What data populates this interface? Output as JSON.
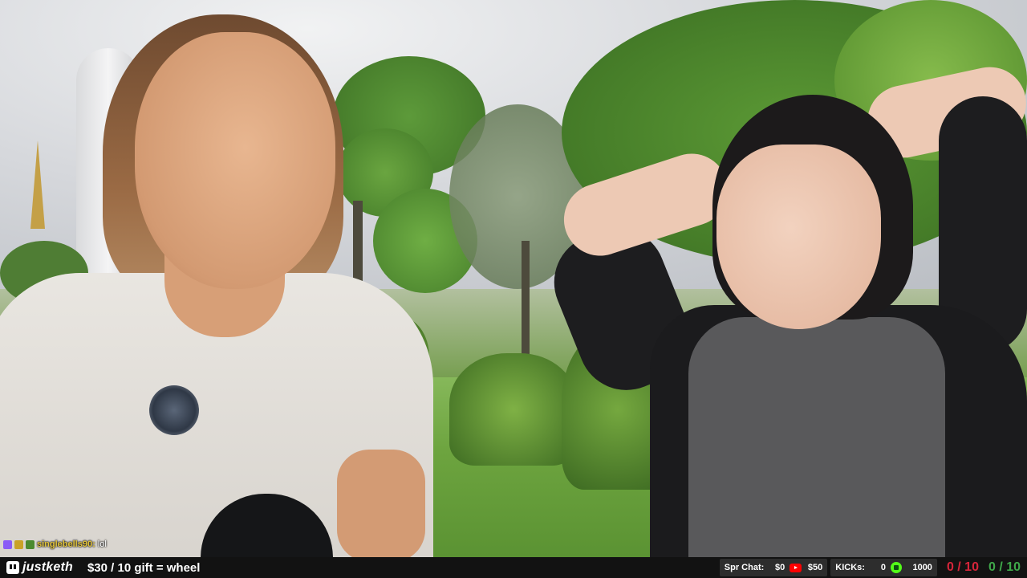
{
  "chat": {
    "username": "singlebells90:",
    "message": "lol"
  },
  "ticker": {
    "channel_name": "justketh",
    "promo_text": "$30 / 10 gift = wheel",
    "spr_chat_label": "Spr Chat:",
    "spr_chat_value": "$0",
    "youtube_value": "$50",
    "kicks_label": "KICKs:",
    "kicks_value": "0",
    "kick_goal": "1000",
    "counter_red": "0 / 10",
    "counter_green": "0 / 10"
  },
  "colors": {
    "bar_background": "#121212",
    "counter_red": "#d6253a",
    "counter_green": "#3fa84a",
    "chat_username": "#e3c43a",
    "kick_green": "#53fc18",
    "youtube_red": "#ff0000"
  },
  "icons": [
    "twitch-icon",
    "youtube-icon",
    "kick-icon"
  ]
}
